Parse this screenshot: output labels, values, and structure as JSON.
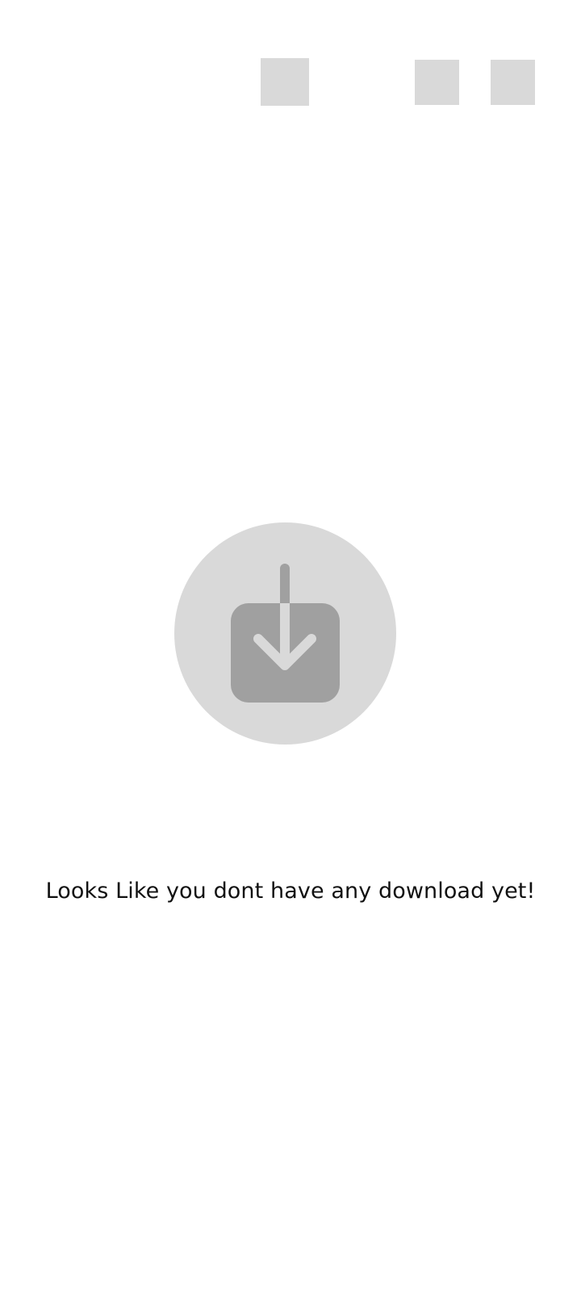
{
  "header": {
    "placeholders": [
      {
        "icon": "image-placeholder-icon"
      },
      {
        "icon": "image-placeholder-icon"
      },
      {
        "icon": "image-placeholder-icon"
      }
    ]
  },
  "empty_state": {
    "icon": "download-icon",
    "message": "Looks Like you dont have any download yet!"
  },
  "colors": {
    "placeholder": "#d9d9d9",
    "icon_circle": "#d9d9d9",
    "icon_glyph": "#a0a0a0",
    "text": "#111111",
    "background": "#ffffff"
  }
}
